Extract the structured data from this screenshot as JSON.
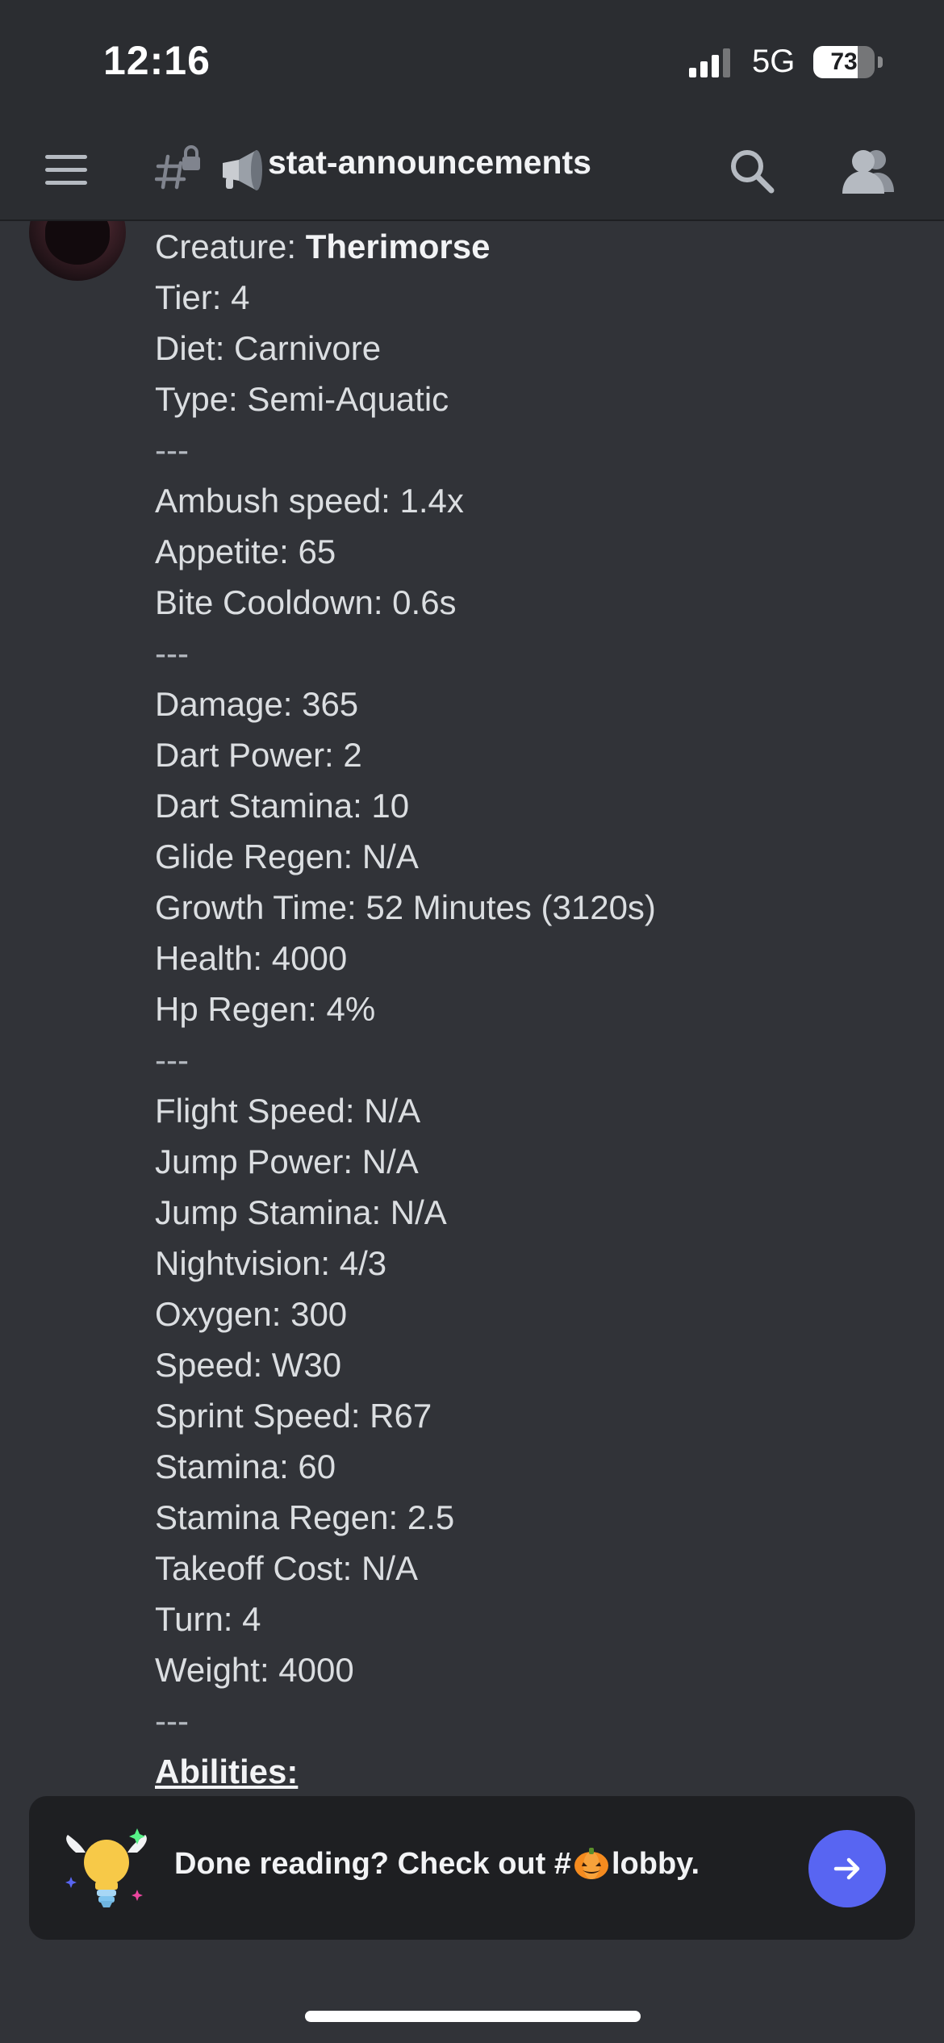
{
  "status_bar": {
    "time": "12:16",
    "network": "5G",
    "battery_percent": "73",
    "battery_level": 0.73
  },
  "header": {
    "channel_name": "stat-announcements",
    "menu_icon": "hamburger-menu-icon",
    "channel_icon": "locked-hash-icon",
    "channel_emoji": "megaphone-icon",
    "search_icon": "search-icon",
    "members_icon": "members-icon"
  },
  "message": {
    "lines": [
      {
        "label": "Creature: ",
        "value": "Therimorse"
      },
      {
        "text": "Tier: 4"
      },
      {
        "text": "Diet: Carnivore"
      },
      {
        "text": "Type: Semi-Aquatic"
      },
      {
        "text": "---"
      },
      {
        "text": "Ambush speed: 1.4x"
      },
      {
        "text": "Appetite: 65"
      },
      {
        "text": "Bite Cooldown: 0.6s"
      },
      {
        "text": "---"
      },
      {
        "text": "Damage: 365"
      },
      {
        "text": "Dart Power: 2"
      },
      {
        "text": "Dart Stamina: 10"
      },
      {
        "text": "Glide Regen: N/A"
      },
      {
        "text": "Growth Time: 52 Minutes (3120s)"
      },
      {
        "text": "Health: 4000"
      },
      {
        "text": "Hp Regen: 4%"
      },
      {
        "text": "---"
      },
      {
        "text": "Flight Speed: N/A"
      },
      {
        "text": "Jump Power: N/A"
      },
      {
        "text": "Jump Stamina: N/A"
      },
      {
        "text": "Nightvision: 4/3"
      },
      {
        "text": "Oxygen: 300"
      },
      {
        "text": "Speed: W30"
      },
      {
        "text": "Sprint Speed: R67"
      },
      {
        "text": "Stamina: 60"
      },
      {
        "text": "Stamina Regen: 2.5"
      },
      {
        "text": "Takeoff Cost: N/A"
      },
      {
        "text": "Turn: 4"
      },
      {
        "text": "Weight: 4000"
      },
      {
        "text": "---"
      },
      {
        "abilities": "Abilities:"
      }
    ]
  },
  "done_banner": {
    "text_before": "Done reading? Check out #",
    "text_after": "lobby.",
    "emoji": "pumpkin-icon",
    "button_icon": "arrow-right-icon"
  },
  "colors": {
    "background": "#313338",
    "header_bg": "#2b2d31",
    "banner_bg": "#1e1f22",
    "accent": "#5865f2"
  }
}
